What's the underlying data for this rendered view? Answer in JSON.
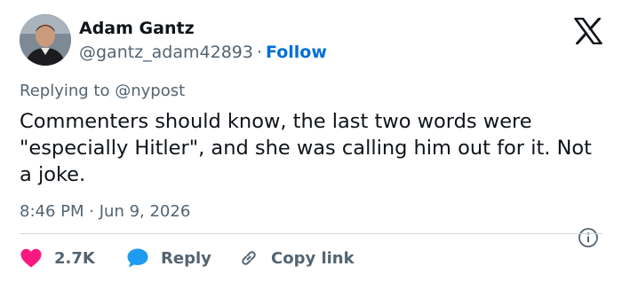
{
  "author": {
    "name": "Adam Gantz",
    "handle": "@gantz_adam42893",
    "separator": "·",
    "follow_label": "Follow"
  },
  "replying": {
    "prefix": "Replying to",
    "mention": "@nypost"
  },
  "tweet": {
    "text": "Commenters should know, the last two words were \"especially Hitler\", and she was calling him out for it. Not a joke.",
    "time": "8:46 PM",
    "separator": "·",
    "date": "Jun 9, 2026"
  },
  "actions": {
    "like_count": "2.7K",
    "reply_label": "Reply",
    "copy_label": "Copy link"
  },
  "icons": {
    "brand": "x-logo-icon",
    "info": "info-icon",
    "like": "heart-icon",
    "reply": "speech-bubble-icon",
    "copy": "link-icon"
  },
  "colors": {
    "text": "#0f1419",
    "secondary": "#536471",
    "link": "#006fd6",
    "heart": "#f91880",
    "reply_bubble": "#1d9bf0",
    "divider": "#cfd9de"
  }
}
